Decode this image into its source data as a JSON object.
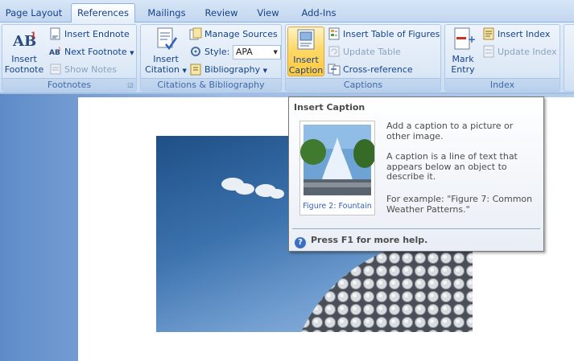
{
  "tabs": [
    "Page Layout",
    "References",
    "Mailings",
    "Review",
    "View",
    "Add-Ins"
  ],
  "footnotes": {
    "insert_footnote_line1": "Insert",
    "insert_footnote_line2": "Footnote",
    "insert_endnote": "Insert Endnote",
    "next_footnote": "Next Footnote",
    "show_notes": "Show Notes",
    "group_label": "Footnotes"
  },
  "citations": {
    "insert_citation_line1": "Insert",
    "insert_citation_line2": "Citation",
    "manage_sources": "Manage Sources",
    "style_label": "Style:",
    "style_value": "APA",
    "bibliography": "Bibliography",
    "group_label": "Citations & Bibliography"
  },
  "captions": {
    "insert_caption_line1": "Insert",
    "insert_caption_line2": "Caption",
    "insert_table_of_figures": "Insert Table of Figures",
    "update_table": "Update Table",
    "cross_reference": "Cross-reference",
    "group_label": "Captions"
  },
  "index": {
    "mark_entry_line1": "Mark",
    "mark_entry_line2": "Entry",
    "insert_index": "Insert Index",
    "update_index": "Update Index",
    "group_label": "Index"
  },
  "tooltip": {
    "title": "Insert Caption",
    "thumb_caption": "Figure 2: Fountain",
    "desc1": "Add a caption to a picture or other image.",
    "desc2": "A caption is a line of text that appears below an object to describe it.",
    "desc3": "For example: \"Figure 7: Common Weather Patterns.\"",
    "help": "Press F1 for more help."
  },
  "colors": {
    "ribbon_text": "#15428b",
    "highlight": "#ffd96a",
    "tooltip_text": "#4c4c4c"
  }
}
